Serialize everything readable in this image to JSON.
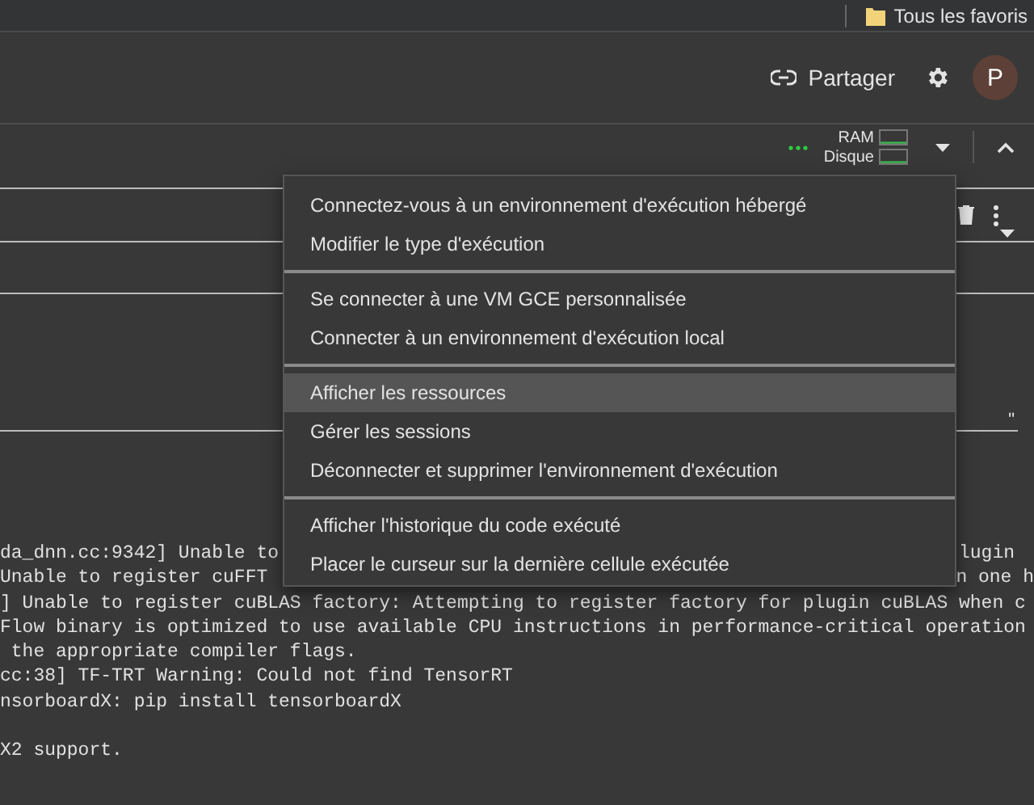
{
  "bookmarks_bar": {
    "folder": "Tous les favoris"
  },
  "header": {
    "share": "Partager",
    "avatar": "P"
  },
  "toolbar": {
    "resources": [
      {
        "label": "RAM"
      },
      {
        "label": "Disque"
      }
    ]
  },
  "cell": {
    "marker": "\""
  },
  "menu": {
    "sections": [
      [
        {
          "label": "Connectez-vous à un environnement d'exécution hébergé",
          "selected": false
        },
        {
          "label": "Modifier le type d'exécution",
          "selected": false
        }
      ],
      [
        {
          "label": "Se connecter à une VM GCE personnalisée",
          "selected": false
        },
        {
          "label": "Connecter à un environnement d'exécution local",
          "selected": false
        }
      ],
      [
        {
          "label": "Afficher les ressources",
          "selected": true
        },
        {
          "label": "Gérer les sessions",
          "selected": false
        },
        {
          "label": "Déconnecter et supprimer l'environnement d'exécution",
          "selected": false
        }
      ],
      [
        {
          "label": "Afficher l'historique du code exécuté",
          "selected": false
        },
        {
          "label": "Placer le curseur sur la dernière cellule exécutée",
          "selected": false
        }
      ]
    ]
  },
  "output": {
    "lines": [
      {
        "kind": "text",
        "left": "da_dnn.cc:9342] Unable to",
        "right": "lugin"
      },
      {
        "kind": "text",
        "left": "Unable to register cuFFT",
        "right": "n one h"
      },
      {
        "kind": "text",
        "left": "] Unable to register cuBLAS factory: Attempting to register factory for plugin cuBLAS when c"
      },
      {
        "kind": "text",
        "left": "Flow binary is optimized to use available CPU instructions in performance-critical operation"
      },
      {
        "kind": "text",
        "left": " the appropriate compiler flags."
      },
      {
        "kind": "text",
        "left": "cc:38] TF-TRT Warning: Could not find TensorRT"
      },
      {
        "kind": "text",
        "left": "nsorboardX: pip install tensorboardX"
      },
      {
        "kind": "blank"
      },
      {
        "kind": "text",
        "left": "X2 support."
      }
    ]
  }
}
